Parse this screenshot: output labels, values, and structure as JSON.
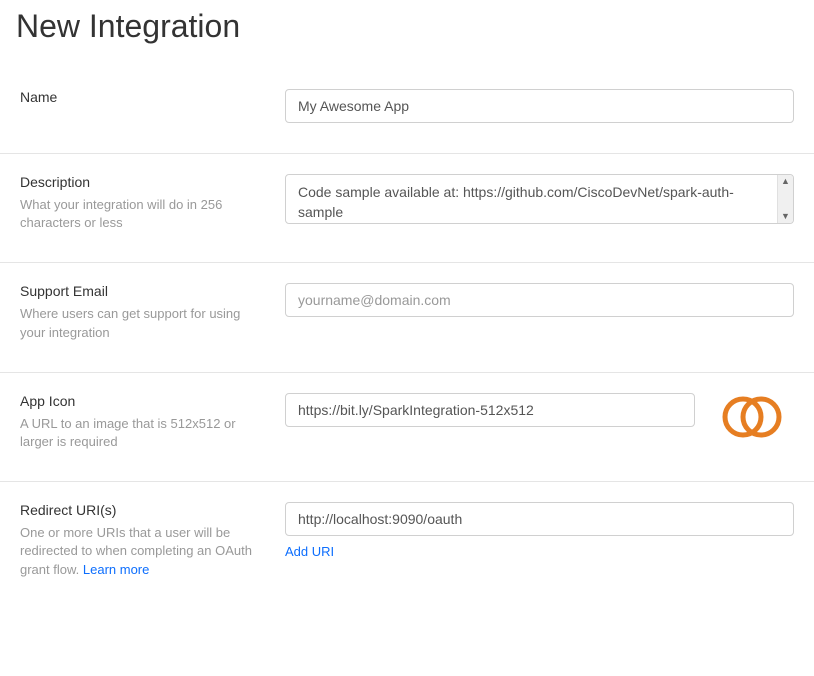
{
  "page": {
    "title": "New Integration"
  },
  "fields": {
    "name": {
      "label": "Name",
      "value": "My Awesome App"
    },
    "description": {
      "label": "Description",
      "hint": "What your integration will do in 256 characters or less",
      "value": "Code sample available at: https://github.com/CiscoDevNet/spark-auth-sample"
    },
    "support_email": {
      "label": "Support Email",
      "hint": "Where users can get support for using your integration",
      "placeholder": "yourname@domain.com",
      "value": ""
    },
    "app_icon": {
      "label": "App Icon",
      "hint": "A URL to an image that is 512x512 or larger is required",
      "value": "https://bit.ly/SparkIntegration-512x512"
    },
    "redirect_uris": {
      "label": "Redirect URI(s)",
      "hint_prefix": "One or more URIs that a user will be redirected to when completing an OAuth grant flow. ",
      "learn_more": "Learn more",
      "value": "http://localhost:9090/oauth",
      "add_label": "Add URI"
    }
  }
}
